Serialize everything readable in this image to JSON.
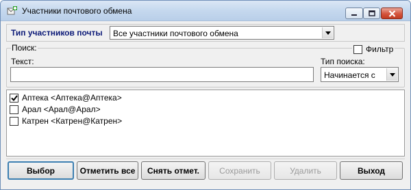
{
  "window": {
    "title": "Участники почтового обмена"
  },
  "type_row": {
    "label": "Тип участников почты",
    "selected": "Все участники почтового обмена"
  },
  "search": {
    "legend": "Поиск:",
    "filter_label": "Фильтр",
    "filter_checked": false,
    "text_label": "Текст:",
    "text_value": "",
    "search_type_label": "Тип поиска:",
    "search_type_selected": "Начинается с"
  },
  "list": {
    "items": [
      {
        "label": "Аптека <Аптека@Аптека>",
        "checked": true
      },
      {
        "label": "Арал <Арал@Арал>",
        "checked": false
      },
      {
        "label": "Катрен <Катрен@Катрен>",
        "checked": false
      }
    ]
  },
  "buttons": {
    "select": "Выбор",
    "mark_all": "Отметить все",
    "unmark": "Снять отмет.",
    "save": "Сохранить",
    "delete": "Удалить",
    "exit": "Выход"
  },
  "colors": {
    "label_accent": "#0c1a78",
    "primary_border": "#3c7fb1",
    "disabled_text": "#9a9a9a"
  }
}
